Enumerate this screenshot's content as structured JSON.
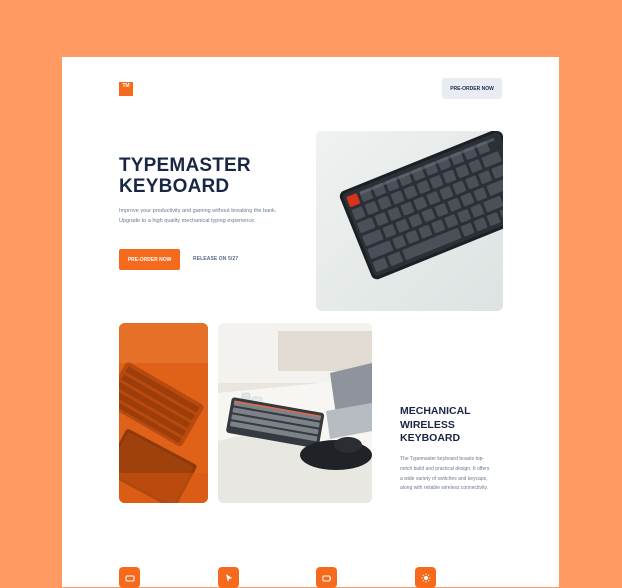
{
  "brand": {
    "logo_text": "TM"
  },
  "nav": {
    "preorder_label": "PRE-ORDER NOW"
  },
  "hero": {
    "title_line1": "TYPEMASTER",
    "title_line2": "KEYBOARD",
    "description": "Improve your productivity and gaming without breaking the bank. Upgrade to a high quality mechanical typing experience.",
    "cta_label": "PRE-ORDER NOW",
    "release_label": "RELEASE ON 5/27"
  },
  "feature": {
    "title_line1": "MECHANICAL",
    "title_line2": "WIRELESS",
    "title_line3": "KEYBOARD",
    "description": "The Typemaster keyboard boasts top-notch build and practical design. It offers a wide variety of switches and keycaps, along with reliable wireless connectivity."
  },
  "icons": [
    "keyboard-feature-icon",
    "cursor-feature-icon",
    "battery-feature-icon",
    "light-feature-icon"
  ],
  "colors": {
    "background": "#ff9a63",
    "accent": "#f56a1c",
    "heading": "#1a2744",
    "nav_button": "#e9edf3"
  }
}
